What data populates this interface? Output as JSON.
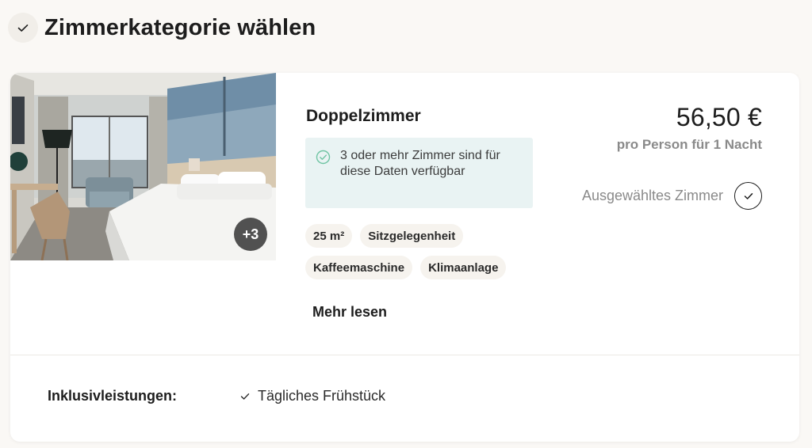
{
  "header": {
    "title": "Zimmerkategorie wählen",
    "status_icon": "check-icon"
  },
  "room": {
    "image": {
      "description_icon": "room-photo",
      "more_photos": "+3"
    },
    "name": "Doppelzimmer",
    "availability": {
      "icon": "check-circle-icon",
      "text": "3 oder mehr Zimmer sind für diese Daten verfügbar",
      "color": "#e9f3f3",
      "icon_color": "#6fc4a3"
    },
    "tags": [
      "25 m²",
      "Sitzgelegenheit",
      "Kaffeemaschine",
      "Klimaanlage"
    ],
    "read_more": "Mehr lesen",
    "price": "56,50 €",
    "price_note": "pro Person für 1 Nacht",
    "selected_label": "Ausgewähltes Zimmer",
    "selected_icon": "check-icon"
  },
  "inclusions": {
    "label": "Inklusivleistungen:",
    "items": [
      {
        "icon": "check-icon",
        "text": "Tägliches Frühstück"
      }
    ]
  }
}
